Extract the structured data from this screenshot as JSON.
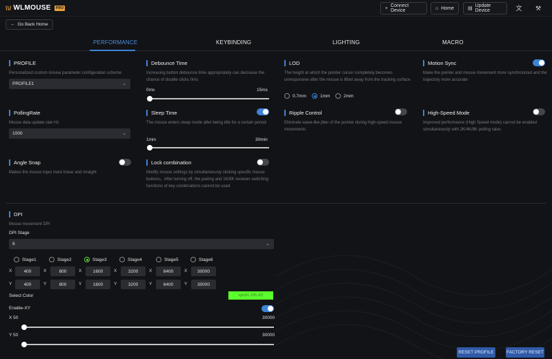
{
  "app": {
    "logo_text": "WLMOUSE",
    "logo_badge": "PRO"
  },
  "topbar": {
    "connect_label": "Connect Device",
    "home_label": "Home",
    "update_label": "Update Device"
  },
  "back_label": "Go Back Home",
  "tabs": [
    {
      "label": "PERFORMANCE",
      "active": true
    },
    {
      "label": "KEYBINDING",
      "active": false
    },
    {
      "label": "LIGHTING",
      "active": false
    },
    {
      "label": "MACRO",
      "active": false
    }
  ],
  "settings": {
    "profile": {
      "title": "PROFILE",
      "desc": "Personalized custom mouse parameter configuration scheme",
      "value": "PROFILE1"
    },
    "debounce": {
      "title": "Debounce Time",
      "desc": "Increasing button debounce time appropriately can decrease the chance of double clicks 0ms",
      "min": "0ms",
      "max": "15ms",
      "level": 0
    },
    "lod": {
      "title": "LOD",
      "desc": "The height at which the pointer cursor completely becomes unresponsive after the mouse is lifted away from the tracking surface",
      "options": [
        "0.7mm",
        "1mm",
        "2mm"
      ],
      "selected": "1mm"
    },
    "motion_sync": {
      "title": "Motion Sync",
      "desc": "Make the pointer and mouse movement more synchronized and the trajectory more accurate",
      "on": true
    },
    "polling": {
      "title": "PollingRate",
      "desc": "Mouse data update rate Hz",
      "value": "1000"
    },
    "sleep": {
      "title": "Sleep Time",
      "desc": "The mouse enters sleep mode after being idle for a certain period",
      "min": "1min",
      "max": "30min",
      "on": true,
      "level": 0
    },
    "ripple": {
      "title": "Ripple Control",
      "desc": "Eliminate wave-like jitter of the pointer during high-speed mouse movements",
      "on": false
    },
    "high_speed": {
      "title": "High-Speed Mode",
      "desc": "Improved performance (High Speed mode) cannot be enabled simultaneously with 2K/4K/8K polling rates",
      "on": false
    },
    "angle_snap": {
      "title": "Angle Snap",
      "desc": "Makes the mouse input more linear and straight",
      "on": false
    },
    "lock_combo": {
      "title": "Lock combination",
      "desc": "Modify mouse settings by simultaneously clicking specific mouse buttons。After turning off, the pairing and 1K/8K receiver switching functions of key combinations cannot be used",
      "on": false
    }
  },
  "dpi": {
    "title": "DPI",
    "desc": "Mouse movement DPI",
    "stage_label": "DPI Stage",
    "stage_count": "6",
    "stages": [
      {
        "label": "Stage1",
        "x": "400",
        "y": "400",
        "selected": false
      },
      {
        "label": "Stage2",
        "x": "800",
        "y": "800",
        "selected": false
      },
      {
        "label": "Stage3",
        "x": "1600",
        "y": "1600",
        "selected": true
      },
      {
        "label": "Stage4",
        "x": "3200",
        "y": "3200",
        "selected": false
      },
      {
        "label": "Stage5",
        "x": "6400",
        "y": "6400",
        "selected": false
      },
      {
        "label": "Stage6",
        "x": "30000",
        "y": "30000",
        "selected": false
      }
    ],
    "x_axis": "X",
    "y_axis": "Y",
    "select_color_label": "Select Color",
    "color_value": "rgb(91,255,43)",
    "color_hex": "#5bff2b",
    "enable_xy_label": "Enable-XY",
    "enable_xy_on": true,
    "x_slider_label": "X 50",
    "x_slider_max": "30000",
    "x_slider_level": 0.0,
    "y_slider_label": "Y 50",
    "y_slider_max": "30000",
    "y_slider_level": 0.0
  },
  "buttons": {
    "reset_profile": "RESET PROFILE",
    "factory_reset": "FACTORY RESET"
  },
  "colors": {
    "accent": "#3e84d8",
    "stage_selected": "#5dd33a"
  }
}
